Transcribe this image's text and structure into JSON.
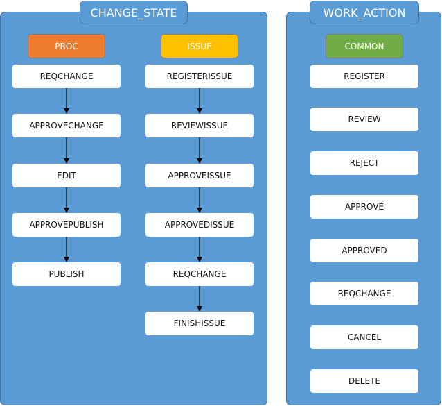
{
  "colors": {
    "panel": "#5b9bd5",
    "panel_border": "#41719c",
    "proc": "#ed7d31",
    "issue": "#ffc000",
    "common": "#70ad47",
    "node": "#ffffff"
  },
  "change_state": {
    "title": "CHANGE_STATE",
    "proc": {
      "label": "PROC",
      "steps": [
        "REQCHANGE",
        "APPROVECHANGE",
        "EDIT",
        "APPROVEPUBLISH",
        "PUBLISH"
      ]
    },
    "issue": {
      "label": "ISSUE",
      "steps": [
        "REGISTERISSUE",
        "REVIEWISSUE",
        "APPROVEISSUE",
        "APPROVEDISSUE",
        "REQCHANGE",
        "FINISHISSUE"
      ]
    }
  },
  "work_action": {
    "title": "WORK_ACTION",
    "common": {
      "label": "COMMON",
      "actions": [
        "REGISTER",
        "REVIEW",
        "REJECT",
        "APPROVE",
        "APPROVED",
        "REQCHANGE",
        "CANCEL",
        "DELETE"
      ]
    }
  }
}
